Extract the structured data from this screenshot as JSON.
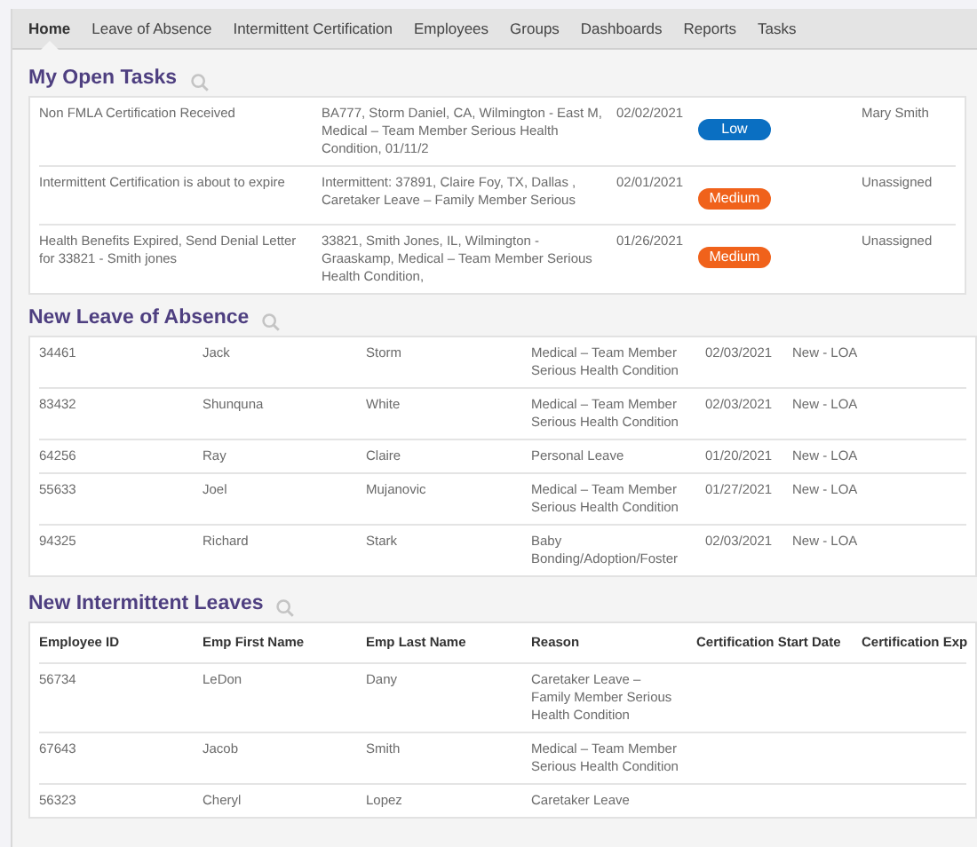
{
  "tabs": [
    {
      "label": "Home",
      "selected": true
    },
    {
      "label": "Leave of Absence",
      "selected": false
    },
    {
      "label": "Intermittent Certification",
      "selected": false
    },
    {
      "label": "Employees",
      "selected": false
    },
    {
      "label": "Groups",
      "selected": false
    },
    {
      "label": "Dashboards",
      "selected": false
    },
    {
      "label": "Reports",
      "selected": false
    },
    {
      "label": "Tasks",
      "selected": false
    }
  ],
  "open_tasks": {
    "title": "My Open Tasks",
    "rows": [
      {
        "task": "Non FMLA Certification Received",
        "details": "BA777, Storm Daniel, CA, Wilmington - East M, Medical – Team Member Serious Health Condition, 01/11/2",
        "date": "02/02/2021",
        "priority": {
          "label": "Low",
          "color": "#0a6fc2"
        },
        "assignee": "Mary Smith"
      },
      {
        "task": "Intermittent Certification is about to expire",
        "details": "Intermittent: 37891, Claire Foy, TX, Dallas , Caretaker Leave – Family Member Serious",
        "date": "02/01/2021",
        "priority": {
          "label": "Medium",
          "color": "#f0621b"
        },
        "assignee": "Unassigned"
      },
      {
        "task": "Health Benefits Expired, Send Denial Letter  for 33821 - Smith jones",
        "details": "33821, Smith Jones, IL, Wilmington - Graaskamp, Medical – Team Member Serious Health Condition,",
        "date": "01/26/2021",
        "priority": {
          "label": "Medium",
          "color": "#f0621b"
        },
        "assignee": "Unassigned"
      }
    ]
  },
  "new_leave": {
    "title": "New Leave of Absence",
    "rows": [
      [
        "34461",
        "Jack",
        "Storm",
        "Medical – Team Member Serious Health Condition",
        "02/03/2021",
        "New - LOA"
      ],
      [
        "83432",
        "Shunquna",
        "White",
        "Medical – Team Member Serious Health Condition",
        "02/03/2021",
        "New - LOA"
      ],
      [
        "64256",
        "Ray",
        "Claire",
        "Personal Leave",
        "01/20/2021",
        "New - LOA"
      ],
      [
        "55633",
        "Joel",
        "Mujanovic",
        "Medical – Team Member Serious Health Condition",
        "01/27/2021",
        "New - LOA"
      ],
      [
        "94325",
        "Richard",
        "Stark",
        "Baby Bonding/Adoption/Foster",
        "02/03/2021",
        "New - LOA"
      ]
    ]
  },
  "intermittent": {
    "title": "New Intermittent Leaves",
    "columns": [
      "Employee ID",
      "Emp First Name",
      "Emp Last Name",
      "Reason",
      "Certification Start Date",
      "Certification Exp"
    ],
    "rows": [
      [
        "56734",
        "LeDon",
        "Dany",
        "Caretaker Leave – Family Member Serious Health Condition"
      ],
      [
        "67643",
        "Jacob",
        "Smith",
        "Medical – Team Member Serious Health Condition"
      ],
      [
        "56323",
        "Cheryl",
        "Lopez",
        "Caretaker Leave"
      ]
    ]
  }
}
